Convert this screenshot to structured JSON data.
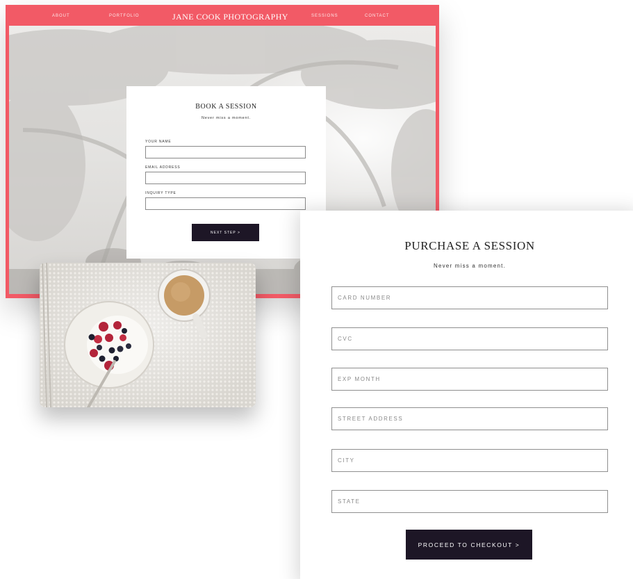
{
  "site": {
    "nav": {
      "about": "ABOUT",
      "portfolio": "PORTFOLIO",
      "brand": "JANE COOK PHOTOGRAPHY",
      "sessions": "SESSIONS",
      "contact": "CONTACT"
    },
    "booking": {
      "title": "BOOK A SESSION",
      "subtitle": "Never miss a moment.",
      "name_label": "YOUR NAME",
      "email_label": "EMAIL ADDRESS",
      "inquiry_label": "INQUIRY TYPE",
      "next_button": "NEXT STEP >"
    },
    "accent_color": "#f25a66"
  },
  "purchase": {
    "title": "PURCHASE A SESSION",
    "subtitle": "Never miss a moment.",
    "fields": {
      "card_number": "CARD NUMBER",
      "cvc": "CVC",
      "exp_month": "EXP MONTH",
      "street_address": "STREET ADDRESS",
      "city": "CITY",
      "state": "STATE"
    },
    "checkout_button": "PROCEED TO CHECKOUT >",
    "button_color": "#1d1626"
  },
  "photo": {
    "subject": "breakfast-photo"
  }
}
